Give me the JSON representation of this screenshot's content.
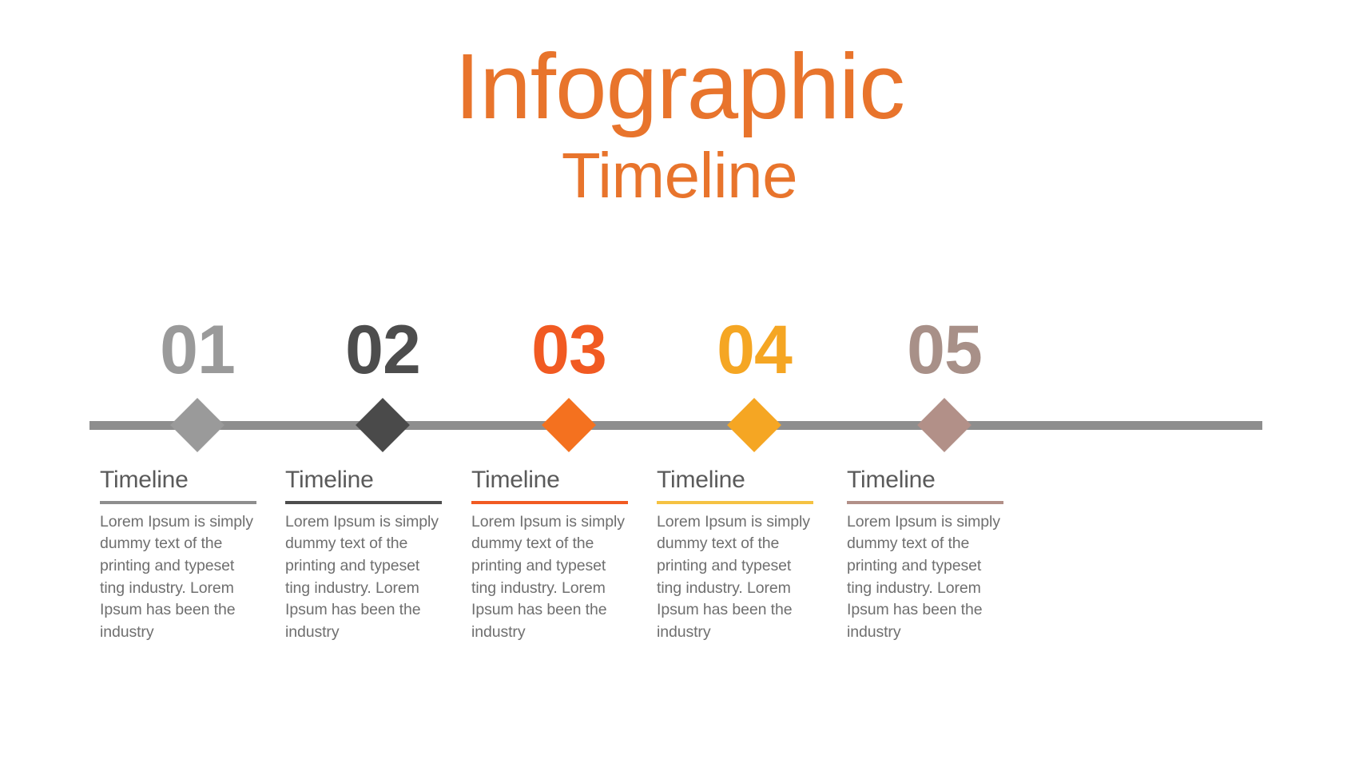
{
  "title": {
    "main": "Infographic",
    "sub": "Timeline",
    "color": "#e8742c"
  },
  "axis": {
    "color": "#8e8e8e"
  },
  "steps": [
    {
      "number": "01",
      "heading": "Timeline",
      "text": "Lorem Ipsum is simply dummy text of the printing and typeset ting industry. Lorem Ipsum has been the industry",
      "color": "#9a9a9a",
      "rule_color": "#8e8e8e",
      "diamond_color": "#9a9a9a"
    },
    {
      "number": "02",
      "heading": "Timeline",
      "text": "Lorem Ipsum is simply dummy text of the printing and typeset ting industry. Lorem Ipsum has been the industry",
      "color": "#4d4d4d",
      "rule_color": "#4d4d4d",
      "diamond_color": "#4a4a4a"
    },
    {
      "number": "03",
      "heading": "Timeline",
      "text": "Lorem Ipsum is simply dummy text of the printing and typeset ting industry. Lorem Ipsum has been the industry",
      "color": "#f15a22",
      "rule_color": "#f15a22",
      "diamond_color": "#f4711f"
    },
    {
      "number": "04",
      "heading": "Timeline",
      "text": "Lorem Ipsum is simply dummy text of the printing and typeset ting industry. Lorem Ipsum has been the industry",
      "color": "#f5a623",
      "rule_color": "#f5c242",
      "diamond_color": "#f5a623"
    },
    {
      "number": "05",
      "heading": "Timeline",
      "text": "Lorem Ipsum is simply dummy text of the printing and typeset ting industry. Lorem Ipsum has been the industry",
      "color": "#a89088",
      "rule_color": "#b29088",
      "diamond_color": "#b29088"
    }
  ],
  "chart_data": {
    "type": "table",
    "title": "Infographic Timeline",
    "categories": [
      "01",
      "02",
      "03",
      "04",
      "05"
    ],
    "labels": [
      "Timeline",
      "Timeline",
      "Timeline",
      "Timeline",
      "Timeline"
    ],
    "colors": [
      "#9a9a9a",
      "#4d4d4d",
      "#f15a22",
      "#f5a623",
      "#a89088"
    ],
    "legend": "none",
    "grid": false
  }
}
